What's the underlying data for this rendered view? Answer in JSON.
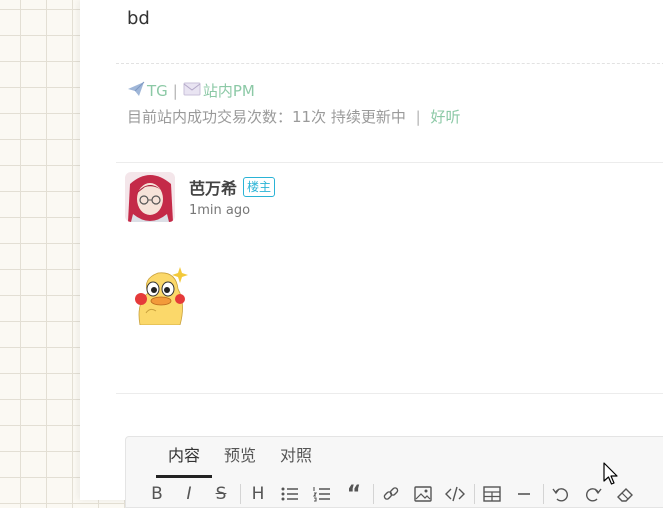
{
  "post": {
    "body_text": "bd",
    "signature": {
      "tg_label": "TG",
      "separator": "|",
      "pm_label": "站内PM",
      "trade_text": "目前站内成功交易次数：11次 持续更新中",
      "link_label": "好听"
    }
  },
  "reply": {
    "author": "芭万希",
    "badge": "楼主",
    "time": "1min ago"
  },
  "editor": {
    "tabs": [
      {
        "label": "内容",
        "active": true
      },
      {
        "label": "预览",
        "active": false
      },
      {
        "label": "对照",
        "active": false
      }
    ],
    "tools": {
      "bold": "B",
      "italic": "I",
      "strike": "S",
      "heading": "H",
      "quote": "“"
    }
  },
  "colors": {
    "link_green": "#8cc9a6",
    "badge_blue": "#2ab3d6",
    "muted_text": "#9a9a9a"
  }
}
